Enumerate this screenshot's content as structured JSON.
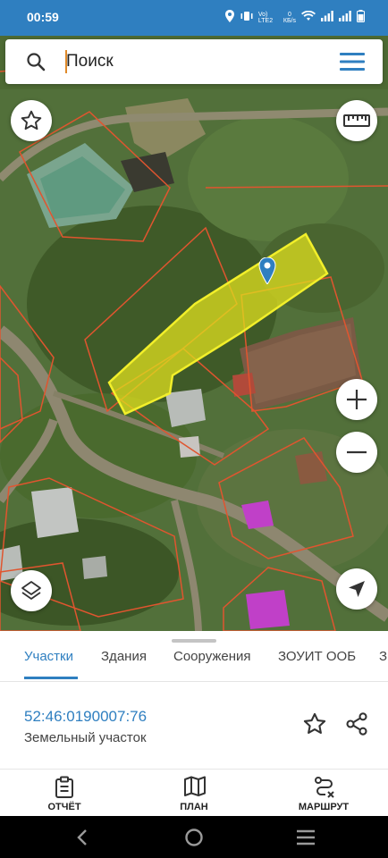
{
  "status_bar": {
    "time": "00:59",
    "network_label": "Vo) LTE2",
    "speed_value": "0",
    "speed_unit": "КБ/s"
  },
  "search": {
    "placeholder": "Поиск"
  },
  "map": {
    "selected_parcel_color": "#e0e01e",
    "boundary_color": "#e0552f"
  },
  "tabs": [
    {
      "label": "Участки",
      "active": true
    },
    {
      "label": "Здания",
      "active": false
    },
    {
      "label": "Сооружения",
      "active": false
    },
    {
      "label": "ЗОУИТ ООБ",
      "active": false
    },
    {
      "label": "З",
      "active": false
    }
  ],
  "parcel": {
    "number": "52:46:0190007:76",
    "type": "Земельный участок"
  },
  "bottom_nav": {
    "report": "ОТЧЁТ",
    "plan": "ПЛАН",
    "route": "МАРШРУТ"
  },
  "colors": {
    "accent": "#2f7fc0",
    "status_bar": "#2f7fc0"
  }
}
